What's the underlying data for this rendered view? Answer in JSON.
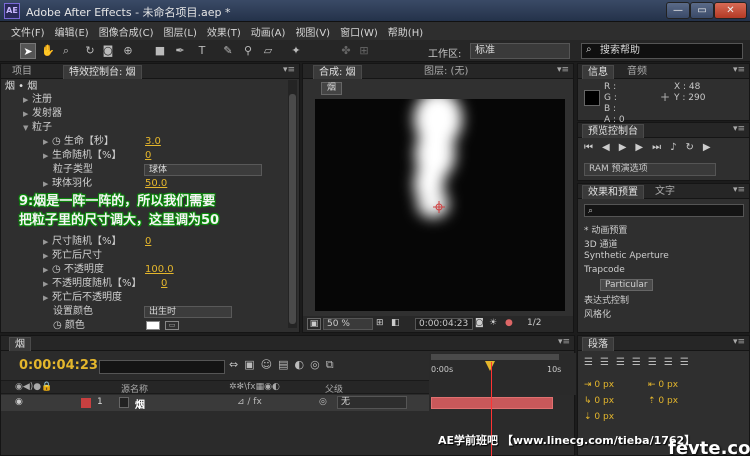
{
  "window": {
    "app_icon_label": "AE",
    "title": "Adobe After Effects - 未命名项目.aep *",
    "minimize": "—",
    "maximize": "▭",
    "close": "✕"
  },
  "menubar": [
    "文件(F)",
    "编辑(E)",
    "图像合成(C)",
    "图层(L)",
    "效果(T)",
    "动画(A)",
    "视图(V)",
    "窗口(W)",
    "帮助(H)"
  ],
  "toolbar": {
    "workspace_label": "工作区:",
    "workspace_value": "标准",
    "search_placeholder": "搜索帮助"
  },
  "effects_panel": {
    "tab_project": "项目",
    "tab_effect_controls": "特效控制台: 烟",
    "layer_path": "烟 • 烟",
    "rows": {
      "reg": "注册",
      "emitter": "发射器",
      "particle": "粒子",
      "life": "生命【秒】",
      "life_val": "3.0",
      "life_random": "生命随机【%】",
      "life_random_val": "0",
      "particle_type": "粒子类型",
      "particle_type_val": "球体",
      "sphere_feather": "球体羽化",
      "sphere_feather_val": "50.0",
      "size_random": "尺寸随机【%】",
      "size_random_val": "0",
      "size_over_life": "死亡后尺寸",
      "opacity": "不透明度",
      "opacity_val": "100.0",
      "opacity_random": "不透明度随机【%】",
      "opacity_random_val": "0",
      "opacity_over_life": "死亡后不透明度",
      "set_color": "设置颜色",
      "set_color_val": "出生时",
      "color": "颜色"
    },
    "annotation_line1": "9:烟是一阵一阵的，所以我们需要",
    "annotation_line2": "把粒子里的尺寸调大，这里调为50"
  },
  "comp_panel": {
    "tab_comp": "合成: 烟",
    "tab_layer": "图层: (无)",
    "comp_chip": "烟",
    "zoom": "50 %",
    "timecode": "0:00:04:23",
    "resolution": "1/2"
  },
  "info_panel": {
    "tab_info": "信息",
    "tab_audio": "音频",
    "r_label": "R :",
    "g_label": "G :",
    "b_label": "B :",
    "a_label": "A : 0",
    "x_readout": "X : 48",
    "y_readout": "Y : 290"
  },
  "preview_panel": {
    "tab": "预览控制台",
    "ram_preview": "RAM 预演选项"
  },
  "effects_presets_panel": {
    "tab_effects": "效果和预置",
    "tab_text": "文字",
    "items": [
      "* 动画预置",
      "3D 通道",
      "Synthetic Aperture",
      "Trapcode",
      "Particular",
      "表达式控制",
      "风格化"
    ]
  },
  "timeline": {
    "tab": "烟",
    "timecode": "0:00:04:23",
    "col_source": "源名称",
    "col_mode": "父级",
    "layer_index": "1",
    "layer_name": "烟",
    "layer_parent": "无",
    "ruler_start": "0:00s",
    "ruler_end": "10s"
  },
  "paragraph_panel": {
    "tab": "段落",
    "px_labels": [
      "0 px",
      "0 px",
      "0 px",
      "0 px",
      "0 px"
    ]
  },
  "watermark": "AE学前班吧  【www.linecg.com/tieba/1762】",
  "logo_mark": "fevte.com",
  "colors": {
    "accent_yellow": "#e4b62c",
    "annotation_outline": "#0a8a0a",
    "track_bar": "#c8585a",
    "cti": "#ff3333"
  }
}
